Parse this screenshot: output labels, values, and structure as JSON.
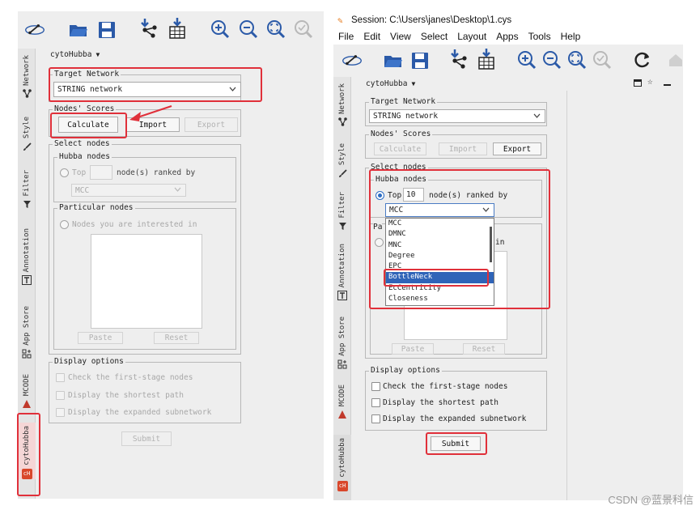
{
  "left_panel": {
    "toolbar_icons": [
      "network-icon",
      "open-folder-icon",
      "save-icon",
      "import-network-icon",
      "import-table-icon",
      "zoom-in-icon",
      "zoom-out-icon",
      "zoom-fit-icon",
      "zoom-selected-icon"
    ],
    "vertical_tabs": [
      {
        "label": "Network",
        "icon": "network-tab-icon"
      },
      {
        "label": "Style",
        "icon": "brush-icon"
      },
      {
        "label": "Filter",
        "icon": "funnel-icon"
      },
      {
        "label": "Annotation",
        "icon": "text-icon"
      },
      {
        "label": "App Store",
        "icon": "app-store-icon"
      },
      {
        "label": "MCODE",
        "icon": "mcode-icon"
      },
      {
        "label": "cytoHubba",
        "icon": "cytohubba-icon"
      }
    ],
    "plugin_title": "cytoHubba",
    "target_network": {
      "title": "Target Network",
      "value": "STRING network"
    },
    "nodes_scores": {
      "title": "Nodes' Scores",
      "calculate": "Calculate",
      "import": "Import",
      "export": "Export"
    },
    "select_nodes": {
      "title": "Select nodes",
      "hubba_title": "Hubba nodes",
      "top_label": "Top",
      "top_value": "",
      "nodes_ranked_by": "node(s) ranked by",
      "method": "MCC",
      "particular_title": "Particular nodes",
      "particular_radio": "Nodes you are interested in",
      "paste": "Paste",
      "reset": "Reset"
    },
    "display_options": {
      "title": "Display options",
      "options": [
        "Check the first-stage nodes",
        "Display the shortest path",
        "Display the expanded subnetwork"
      ]
    },
    "submit": "Submit",
    "cytohubba_badge": "cH"
  },
  "right_panel": {
    "window_title": "Session: C:\\Users\\janes\\Desktop\\1.cys",
    "menu": [
      "File",
      "Edit",
      "View",
      "Select",
      "Layout",
      "Apps",
      "Tools",
      "Help"
    ],
    "plugin_title": "cytoHubba",
    "target_network": {
      "title": "Target Network",
      "value": "STRING network"
    },
    "nodes_scores": {
      "title": "Nodes' Scores",
      "calculate": "Calculate",
      "import": "Import",
      "export": "Export"
    },
    "select_nodes": {
      "title": "Select nodes",
      "hubba_title": "Hubba nodes",
      "top_label": "Top",
      "top_value": "10",
      "nodes_ranked_by": "node(s) ranked by",
      "method": "MCC",
      "particular_short": "Pa",
      "in_label": "in",
      "paste": "Paste",
      "reset": "Reset",
      "method_options": [
        "MCC",
        "DMNC",
        "MNC",
        "Degree",
        "EPC",
        "BottleNeck",
        "EcCentricity",
        "Closeness"
      ],
      "selected_option": "BottleNeck"
    },
    "display_options": {
      "title": "Display options",
      "options": [
        "Check the first-stage nodes",
        "Display the shortest path",
        "Display the expanded subnetwork"
      ]
    },
    "submit": "Submit",
    "cytohubba_badge": "cH"
  },
  "watermark": "CSDN @蓝景科信",
  "colors": {
    "highlight": "#e0303a",
    "selection": "#2f64b8",
    "panel_bg": "#eeeeee",
    "icon_blue": "#2b5aa8"
  }
}
